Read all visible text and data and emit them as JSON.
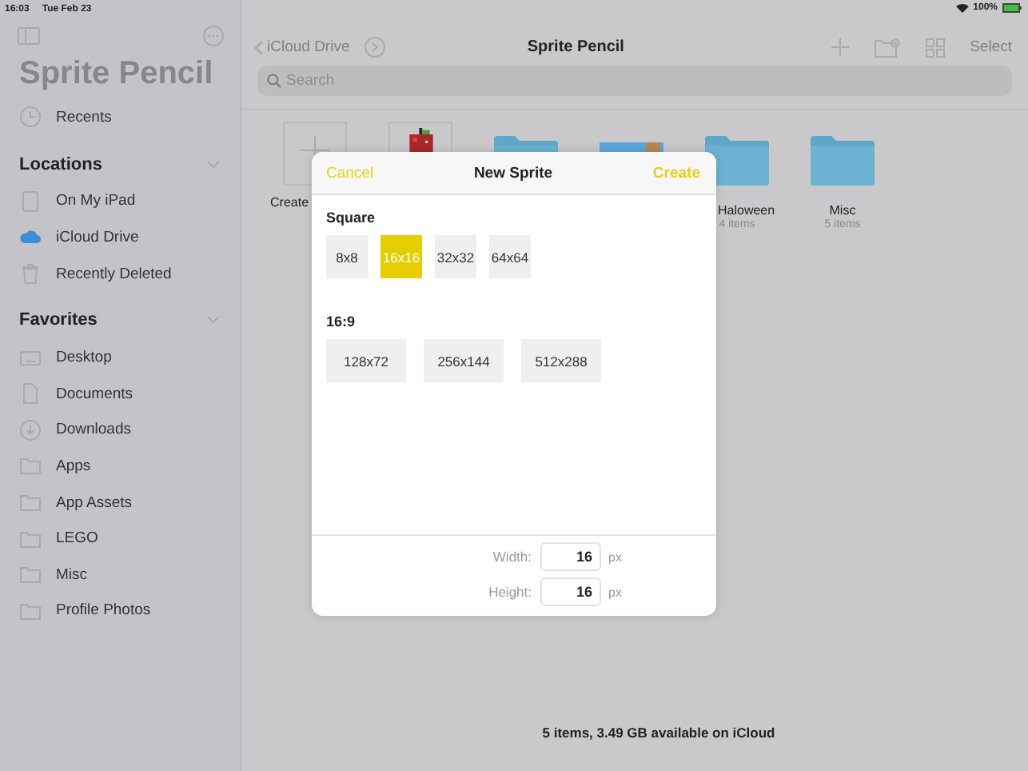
{
  "status_bar": {
    "time": "16:03",
    "date": "Tue Feb 23",
    "battery": "100%"
  },
  "sidebar": {
    "title": "Sprite Pencil",
    "top_items": [
      {
        "label": "Recents",
        "kind": "clock"
      }
    ],
    "sections": [
      {
        "title": "Locations",
        "expanded": true,
        "items": [
          {
            "label": "On My iPad",
            "kind": "ipad"
          },
          {
            "label": "iCloud Drive",
            "kind": "cloud"
          },
          {
            "label": "Recently Deleted",
            "kind": "trash"
          }
        ]
      },
      {
        "title": "Favorites",
        "expanded": true,
        "items": [
          {
            "label": "Desktop",
            "kind": "desktop"
          },
          {
            "label": "Documents",
            "kind": "document"
          },
          {
            "label": "Downloads",
            "kind": "download"
          },
          {
            "label": "Apps",
            "kind": "folder"
          },
          {
            "label": "App Assets",
            "kind": "folder"
          },
          {
            "label": "LEGO",
            "kind": "folder"
          },
          {
            "label": "Misc",
            "kind": "folder"
          },
          {
            "label": "Profile Photos",
            "kind": "folder"
          }
        ]
      }
    ]
  },
  "nav": {
    "back": "iCloud Drive",
    "title": "Sprite Pencil",
    "select": "Select"
  },
  "search": {
    "placeholder": "Search"
  },
  "files": [
    {
      "kind": "create",
      "name": "Create"
    },
    {
      "kind": "apple"
    },
    {
      "kind": "folder"
    },
    {
      "kind": "scene"
    },
    {
      "kind": "folder",
      "name": "Haloween",
      "info": "4 items"
    },
    {
      "kind": "folder",
      "name": "Misc",
      "info": "5 items"
    }
  ],
  "dialog": {
    "cancel": "Cancel",
    "title": "New Sprite",
    "create": "Create",
    "groups": [
      {
        "title": "Square",
        "kind": "square",
        "presets": [
          {
            "label": "8x8",
            "selected": false
          },
          {
            "label": "16x16",
            "selected": true
          },
          {
            "label": "32x32",
            "selected": false
          },
          {
            "label": "64x64",
            "selected": false
          }
        ]
      },
      {
        "title": "16:9",
        "kind": "wide",
        "presets": [
          {
            "label": "128x72",
            "selected": false
          },
          {
            "label": "256x144",
            "selected": false
          },
          {
            "label": "512x288",
            "selected": false
          }
        ]
      }
    ],
    "fields": [
      {
        "label": "Width:",
        "value": "16",
        "unit": "px"
      },
      {
        "label": "Height:",
        "value": "16",
        "unit": "px"
      }
    ]
  },
  "footer": "5 items, 3.49 GB available on iCloud"
}
